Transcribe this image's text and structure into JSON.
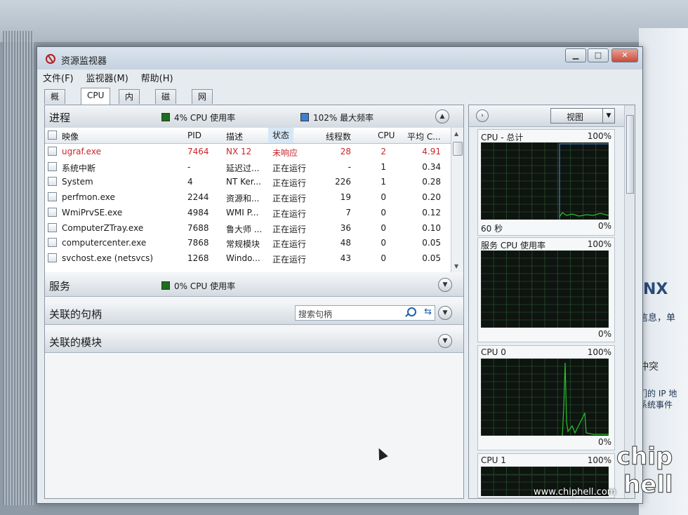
{
  "window": {
    "title": "资源监视器"
  },
  "menu": [
    "文件(F)",
    "监视器(M)",
    "帮助(H)"
  ],
  "tabs": [
    "概述",
    "CPU",
    "内存",
    "磁盘",
    "网络"
  ],
  "active_tab": "CPU",
  "processes": {
    "title": "进程",
    "cpu_usage": "4% CPU 使用率",
    "max_freq": "102% 最大频率",
    "columns": [
      "映像",
      "PID",
      "描述",
      "状态",
      "线程数",
      "CPU",
      "平均 C..."
    ],
    "rows": [
      {
        "name": "ugraf.exe",
        "pid": "7464",
        "desc": "NX 12",
        "status": "未响应",
        "threads": "28",
        "cpu": "2",
        "avg": "4.91",
        "hung": true
      },
      {
        "name": "系统中断",
        "pid": "-",
        "desc": "延迟过...",
        "status": "正在运行",
        "threads": "-",
        "cpu": "1",
        "avg": "0.34"
      },
      {
        "name": "System",
        "pid": "4",
        "desc": "NT Ker...",
        "status": "正在运行",
        "threads": "226",
        "cpu": "1",
        "avg": "0.28"
      },
      {
        "name": "perfmon.exe",
        "pid": "2244",
        "desc": "资源和...",
        "status": "正在运行",
        "threads": "19",
        "cpu": "0",
        "avg": "0.20"
      },
      {
        "name": "WmiPrvSE.exe",
        "pid": "4984",
        "desc": "WMI P...",
        "status": "正在运行",
        "threads": "7",
        "cpu": "0",
        "avg": "0.12"
      },
      {
        "name": "ComputerZTray.exe",
        "pid": "7688",
        "desc": "鲁大师 ...",
        "status": "正在运行",
        "threads": "36",
        "cpu": "0",
        "avg": "0.10"
      },
      {
        "name": "computercenter.exe",
        "pid": "7868",
        "desc": "常规模块",
        "status": "正在运行",
        "threads": "48",
        "cpu": "0",
        "avg": "0.05"
      },
      {
        "name": "svchost.exe (netsvcs)",
        "pid": "1268",
        "desc": "Windo...",
        "status": "正在运行",
        "threads": "43",
        "cpu": "0",
        "avg": "0.05"
      }
    ]
  },
  "services": {
    "title": "服务",
    "cpu_usage": "0% CPU 使用率"
  },
  "handles": {
    "title": "关联的句柄",
    "search_placeholder": "搜索句柄"
  },
  "modules": {
    "title": "关联的模块"
  },
  "right_panel": {
    "view_label": "视图",
    "graphs": [
      {
        "title": "CPU - 总计",
        "max": "100%",
        "min": "0%",
        "footer": "60 秒"
      },
      {
        "title": "服务 CPU 使用率",
        "max": "100%",
        "min": "0%"
      },
      {
        "title": "CPU 0",
        "max": "100%",
        "min": "0%"
      },
      {
        "title": "CPU 1",
        "max": "100%"
      }
    ]
  },
  "background": {
    "brand": "NX",
    "lines": [
      "信息，单",
      "冲突",
      "们的 IP 地",
      "系统事件"
    ]
  },
  "watermark": "www.chiphell.com",
  "logo_text": "chiphell",
  "colors": {
    "hung_text": "#c8262b",
    "graph_line": "#29c229",
    "graph_bg": "#0e1410",
    "max_freq_line": "#3c7fd0"
  }
}
